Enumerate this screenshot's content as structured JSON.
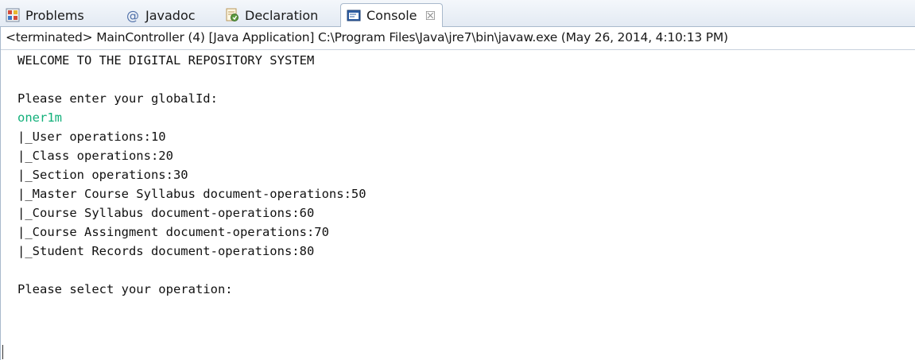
{
  "tabs": [
    {
      "label": "Problems",
      "icon": "problems-icon"
    },
    {
      "label": "Javadoc",
      "icon": "javadoc-at-icon"
    },
    {
      "label": "Declaration",
      "icon": "declaration-icon"
    },
    {
      "label": "Console",
      "icon": "console-icon",
      "active": true,
      "close": "☒"
    }
  ],
  "console": {
    "status": "<terminated> MainController (4) [Java Application] C:\\Program Files\\Java\\jre7\\bin\\javaw.exe (May 26, 2014, 4:10:13 PM)",
    "lines": [
      "WELCOME TO THE DIGITAL REPOSITORY SYSTEM",
      "",
      "Please enter your globalId:",
      "oner1m",
      "|_User operations:10",
      "|_Class operations:20",
      "|_Section operations:30",
      "|_Master Course Syllabus document-operations:50",
      "|_Course Syllabus document-operations:60",
      "|_Course Assingment document-operations:70",
      "|_Student Records document-operations:80",
      "",
      "Please select your operation:"
    ]
  },
  "colors": {
    "user_input": "#12b07a",
    "text": "#111111",
    "tab_border": "#a9b9cc"
  }
}
